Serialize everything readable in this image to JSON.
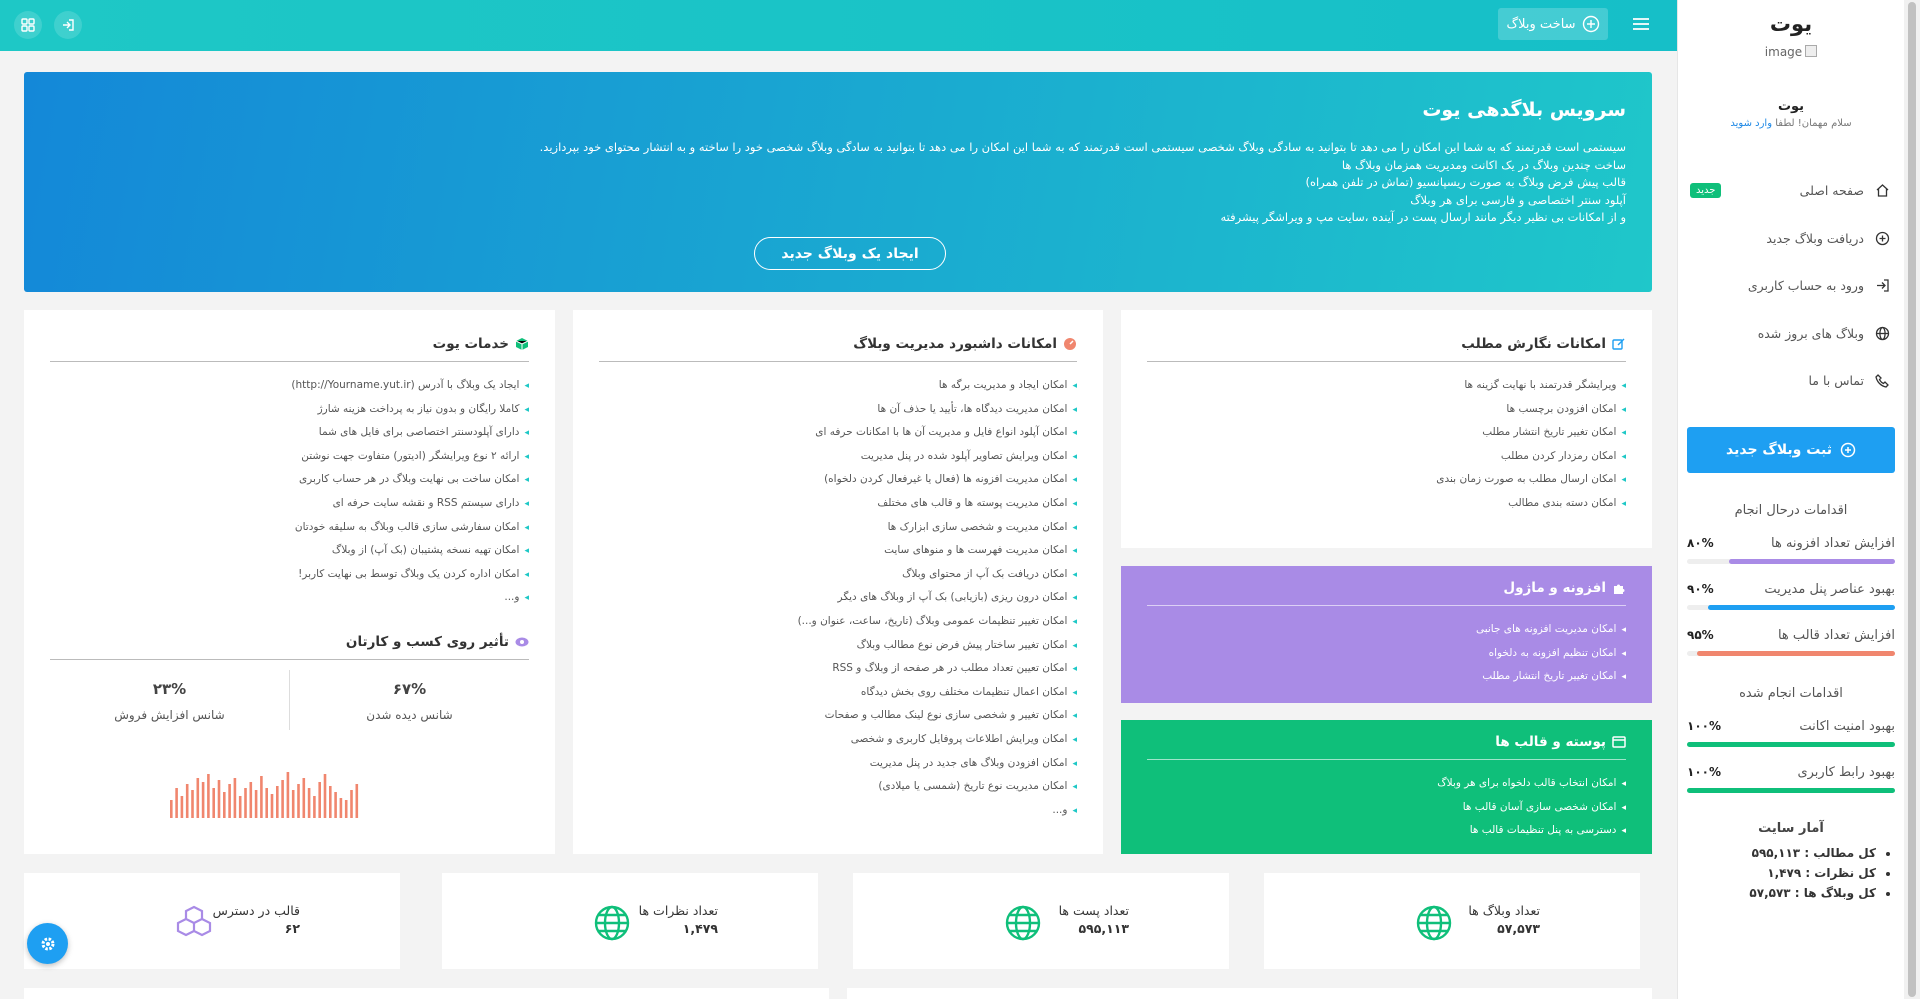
{
  "sidebar": {
    "title": "یوت",
    "image_alt": "image",
    "user_name": "یوت",
    "greeting": "سلام مهمان! لطفا",
    "login_link": "وارد شوید",
    "menu": [
      {
        "label": "صفحه اصلی",
        "icon": "home-icon",
        "badge": "جدید"
      },
      {
        "label": "دریافت وبلاگ جدید",
        "icon": "plus-circle-icon"
      },
      {
        "label": "ورود به حساب کاربری",
        "icon": "login-icon"
      },
      {
        "label": "وبلاگ های بروز شده",
        "icon": "globe-icon"
      },
      {
        "label": "تماس با ما",
        "icon": "phone-icon"
      }
    ],
    "new_blog_button": "ثبت وبلاگ جدید",
    "in_progress_title": "اقدامات درحال انجام",
    "in_progress": [
      {
        "label": "افزایش تعداد افزونه ها",
        "percent_text": "۸۰%",
        "percent": 80,
        "color": "#a98be6"
      },
      {
        "label": "بهبود عناصر پنل مدیریت",
        "percent_text": "۹۰%",
        "percent": 90,
        "color": "#1e9ff2"
      },
      {
        "label": "افزایش تعداد قالب ها",
        "percent_text": "۹۵%",
        "percent": 95,
        "color": "#f0866e"
      }
    ],
    "done_title": "اقدامات انجام شده",
    "done": [
      {
        "label": "بهبود امنیت اکانت",
        "percent_text": "۱۰۰%",
        "percent": 100,
        "color": "#0fbf7a"
      },
      {
        "label": "بهبود رابط کاربری",
        "percent_text": "۱۰۰%",
        "percent": 100,
        "color": "#0fbf7a"
      }
    ],
    "stats_title": "آمار سایت",
    "stats": [
      "کل مطالب : ۵۹۵,۱۱۳",
      "کل نظرات : ۱,۴۷۹",
      "کل وبلاگ ها : ۵۷,۵۷۳"
    ]
  },
  "topbar": {
    "create_label": "ساخت وبلاگ"
  },
  "hero": {
    "title": "سرویس بلاگدهی یوت",
    "lines": [
      "سیستمی است قدرتمند که به شما این امکان را می دهد تا بتوانید به سادگی وبلاگ شخصی سیستمی است قدرتمند که به شما این امکان را می دهد تا بتوانید به سادگی وبلاگ شخصی خود را ساخته و به انتشار محتوای خود بپردازید.",
      "ساخت چندین وبلاگ در یک اکانت ومدیریت همزمان وبلاگ ها",
      "قالب پیش فرض وبلاگ به صورت ریسپانسیو (تماش در تلفن همراه)",
      "آپلود سنتر اختصاصی و فارسی برای هر وبلاگ",
      "و از امکانات بی نظیر دیگر مانند ارسال پست در آینده ،سایت مپ و ویراشگر پیشرفته"
    ],
    "cta": "ایجاد یک وبلاگ جدید"
  },
  "writing": {
    "title": "امکانات نگارش مطلب",
    "items": [
      "ویرایشگر قدرتمند با نهایت گزینه ها",
      "امکان افزودن برچسب ها",
      "امکان تغییر تاریخ انتشار مطلب",
      "امکان رمزدار کردن مطلب",
      "امکان ارسال مطلب به صورت زمان بندی",
      "امکان دسته بندی مطالب"
    ]
  },
  "plugins": {
    "title": "افزونه و ماژول",
    "color": "#a98be6",
    "items": [
      "امکان مدیریت افزونه های جانبی",
      "امکان تنظیم افزونه به دلخواه",
      "امکان تغییر تاریخ انتشار مطلب"
    ]
  },
  "themes": {
    "title": "پوسته و قالب ها",
    "color": "#0fbf7a",
    "items": [
      "امکان انتخاب قالب دلخواه برای هر وبلاگ",
      "امکان شخصی سازی آسان قالب ها",
      "دسترسی به پنل تنظیمات قالب ها"
    ]
  },
  "dashboard": {
    "title": "امکانات داشبورد مدیریت وبلاگ",
    "items": [
      "امکان ایجاد و مدیریت برگه ها",
      "امکان مدیریت دیدگاه ها، تأیید یا حذف آن ها",
      "امکان آپلود انواع فایل و مدیریت آن ها با امکانات حرفه ای",
      "امکان ویرایش تصاویر آپلود شده در پنل مدیریت",
      "امکان مدیریت افزونه ها (فعال یا غیرفعال کردن دلخواه)",
      "امکان مدیریت پوسته ها و قالب های مختلف",
      "امکان مدیریت و شخصی سازی ابزارک ها",
      "امکان مدیریت فهرست ها و منوهای سایت",
      "امکان دریافت بک آپ از محتوای وبلاگ",
      "امکان درون ریزی (بازیابی) بک آپ از وبلاگ های دیگر",
      "امکان تغییر تنظیمات عمومی وبلاگ (تاریخ، ساعت، عنوان و...)",
      "امکان تغییر ساختار پیش فرض نوع مطالب وبلاگ",
      "امکان تعیین تعداد مطلب در هر صفحه از وبلاگ و RSS",
      "امکان اعمال تنظیمات مختلف روی بخش دیدگاه",
      "امکان تغییر و شخصی سازی نوع لینک مطالب و صفحات",
      "امکان ویرایش اطلاعات پروفایل کاربری و شخصی",
      "امکان افزودن وبلاگ های جدید در پنل مدیریت",
      "امکان مدیریت نوع تاریخ (شمسی یا میلادی)",
      "و..."
    ]
  },
  "services": {
    "title": "خدمات یوت",
    "items": [
      "ایجاد یک وبلاگ با آدرس (http://Yourname.yut.ir)",
      "کاملا رایگان و بدون نیاز به پرداخت هزینه شارژ",
      "دارای آپلودسنتر اختصاصی برای فایل های شما",
      "ارائه ۲ نوع ویرایشگر (ادیتور) متفاوت جهت نوشتن",
      "امکان ساخت بی نهایت وبلاگ در هر حساب کاربری",
      "دارای سیستم RSS و نقشه سایت حرفه ای",
      "امکان سفارشی سازی قالب وبلاگ به سلیقه خودتان",
      "امکان تهیه نسخه پشتیبان (بک آپ) از وبلاگ",
      "امکان اداره کردن یک وبلاگ توسط بی نهایت کاربر!",
      "و..."
    ],
    "impact_title": "تأثیر روی کسب و کارتان",
    "impact": [
      {
        "value": "۶۷%",
        "label": "شانس دیده شدن"
      },
      {
        "value": "۲۳%",
        "label": "شانس افزایش فروش"
      }
    ]
  },
  "stat_boxes": [
    {
      "label": "تعداد وبلاگ ها",
      "value": "۵۷,۵۷۳",
      "icon": "globe-icon"
    },
    {
      "label": "تعداد پست ها",
      "value": "۵۹۵,۱۱۳",
      "icon": "globe-icon"
    },
    {
      "label": "تعداد نظرات ها",
      "value": "۱,۴۷۹",
      "icon": "globe-icon"
    },
    {
      "label": "قالب در دسترس",
      "value": "۶۲",
      "icon": "boxes-icon"
    }
  ],
  "colors": {
    "topbar": "#1ec8c6",
    "primary": "#1e9ff2",
    "green": "#0fbf7a",
    "purple": "#a98be6",
    "orange": "#f0866e"
  }
}
